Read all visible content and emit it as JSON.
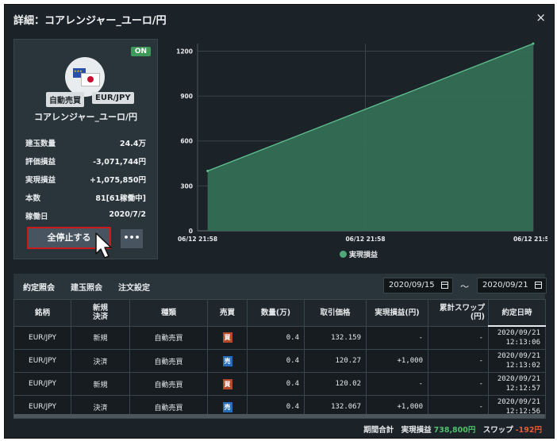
{
  "window": {
    "title": "詳細：コアレンジャー_ユーロ/円",
    "close_glyph": "×"
  },
  "card": {
    "status_badge": "ON",
    "tags": [
      "自動売買",
      "EUR/JPY"
    ],
    "strategy_name": "コアレンジャー_ユーロ/円",
    "info": [
      {
        "label": "建玉数量",
        "value": "24.4万"
      },
      {
        "label": "評価損益",
        "value": "-3,071,744円"
      },
      {
        "label": "実現損益",
        "value": "+1,075,850円"
      },
      {
        "label": "本数",
        "value": "81[61稼働中]"
      },
      {
        "label": "稼働日",
        "value": "2020/7/2"
      }
    ],
    "stop_all_label": "全停止する",
    "more_label": "•••"
  },
  "chart_data": {
    "type": "area",
    "x": [
      "06/12 21:58",
      "06/12 21:59"
    ],
    "y": [
      400,
      1250
    ],
    "x_tick_labels": [
      "06/12 21:58",
      "06/12 21:58",
      "06/12 21:59"
    ],
    "y_ticks": [
      0,
      300,
      600,
      900,
      1200
    ],
    "ylim": [
      0,
      1250
    ],
    "series": [
      {
        "name": "実現損益",
        "color": "#3f8f6a"
      }
    ],
    "legend_position": "bottom",
    "grid": true
  },
  "tabs": [
    {
      "label": "約定照会",
      "active": true
    },
    {
      "label": "建玉照会",
      "active": false
    },
    {
      "label": "注文設定",
      "active": false
    }
  ],
  "date_filter": {
    "from": "2020/09/15",
    "to": "2020/09/21",
    "separator": "～"
  },
  "table": {
    "headers": [
      "銘柄",
      "新規\n決済",
      "種類",
      "売買",
      "数量(万)",
      "取引価格",
      "実現損益(円)",
      "累計スワップ\n(円)",
      "約定日時"
    ],
    "rows": [
      {
        "symbol": "EUR/JPY",
        "kind": "新規",
        "type": "自動売買",
        "side": "買",
        "side_type": "buy",
        "qty": "0.4",
        "price": "132.159",
        "pl": "-",
        "swap": "-",
        "date": "2020/09/21",
        "time": "12:13:06"
      },
      {
        "symbol": "EUR/JPY",
        "kind": "決済",
        "type": "自動売買",
        "side": "売",
        "side_type": "sell",
        "qty": "0.4",
        "price": "120.27",
        "pl": "+1,000",
        "swap": "-",
        "date": "2020/09/21",
        "time": "12:13:02"
      },
      {
        "symbol": "EUR/JPY",
        "kind": "新規",
        "type": "自動売買",
        "side": "買",
        "side_type": "buy",
        "qty": "0.4",
        "price": "120.02",
        "pl": "-",
        "swap": "-",
        "date": "2020/09/21",
        "time": "12:12:57"
      },
      {
        "symbol": "EUR/JPY",
        "kind": "決済",
        "type": "自動売買",
        "side": "売",
        "side_type": "sell",
        "qty": "0.4",
        "price": "132.067",
        "pl": "+1,000",
        "swap": "-",
        "date": "2020/09/21",
        "time": "12:12:56"
      }
    ]
  },
  "totals": {
    "period_label": "期間合計",
    "realized_label": "実現損益",
    "realized_value": "738,800円",
    "swap_label": "スワップ",
    "swap_value": "-192円"
  },
  "colors": {
    "accent_green": "#4fc06b",
    "highlight_red": "#d0171a",
    "buy": "#b24a2b",
    "sell": "#2a6bb8"
  }
}
